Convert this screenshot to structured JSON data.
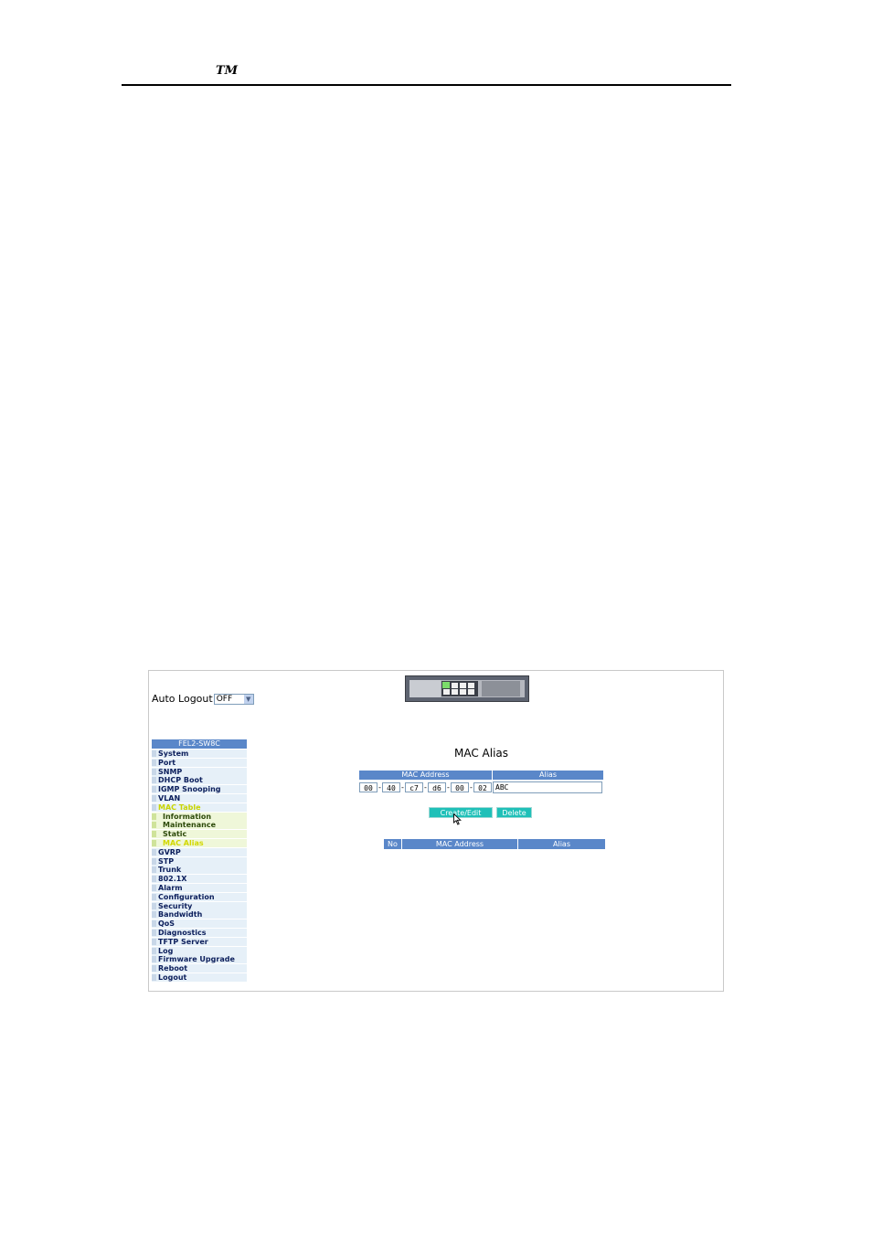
{
  "doc": {
    "trademark": "TM"
  },
  "header": {
    "auto_logout_label": "Auto Logout",
    "auto_logout_value": "OFF"
  },
  "sidebar": {
    "heading": "FEL2-SW8C",
    "items": [
      {
        "label": "System",
        "sub": false,
        "active": false
      },
      {
        "label": "Port",
        "sub": false,
        "active": false
      },
      {
        "label": "SNMP",
        "sub": false,
        "active": false
      },
      {
        "label": "DHCP Boot",
        "sub": false,
        "active": false
      },
      {
        "label": "IGMP Snooping",
        "sub": false,
        "active": false
      },
      {
        "label": "VLAN",
        "sub": false,
        "active": false
      },
      {
        "label": "MAC Table",
        "sub": false,
        "active": true
      },
      {
        "label": "Information",
        "sub": true,
        "active": false
      },
      {
        "label": "Maintenance",
        "sub": true,
        "active": false
      },
      {
        "label": "Static",
        "sub": true,
        "active": false
      },
      {
        "label": "MAC Alias",
        "sub": true,
        "active": true
      },
      {
        "label": "GVRP",
        "sub": false,
        "active": false
      },
      {
        "label": "STP",
        "sub": false,
        "active": false
      },
      {
        "label": "Trunk",
        "sub": false,
        "active": false
      },
      {
        "label": "802.1X",
        "sub": false,
        "active": false
      },
      {
        "label": "Alarm",
        "sub": false,
        "active": false
      },
      {
        "label": "Configuration",
        "sub": false,
        "active": false
      },
      {
        "label": "Security",
        "sub": false,
        "active": false
      },
      {
        "label": "Bandwidth",
        "sub": false,
        "active": false
      },
      {
        "label": "QoS",
        "sub": false,
        "active": false
      },
      {
        "label": "Diagnostics",
        "sub": false,
        "active": false
      },
      {
        "label": "TFTP Server",
        "sub": false,
        "active": false
      },
      {
        "label": "Log",
        "sub": false,
        "active": false
      },
      {
        "label": "Firmware Upgrade",
        "sub": false,
        "active": false
      },
      {
        "label": "Reboot",
        "sub": false,
        "active": false
      },
      {
        "label": "Logout",
        "sub": false,
        "active": false
      }
    ]
  },
  "main": {
    "title": "MAC Alias",
    "form": {
      "col_mac": "MAC Address",
      "col_alias": "Alias",
      "mac_octets": [
        "00",
        "40",
        "c7",
        "d6",
        "00",
        "02"
      ],
      "alias_value": "ABC"
    },
    "buttons": {
      "create_edit": "Create/Edit",
      "delete": "Delete"
    },
    "list": {
      "col_no": "No",
      "col_mac": "MAC Address",
      "col_alias": "Alias"
    }
  },
  "colors": {
    "header_blue": "#5a87c9",
    "button_teal": "#1fc0b8",
    "active_menu": "#c8d400"
  }
}
